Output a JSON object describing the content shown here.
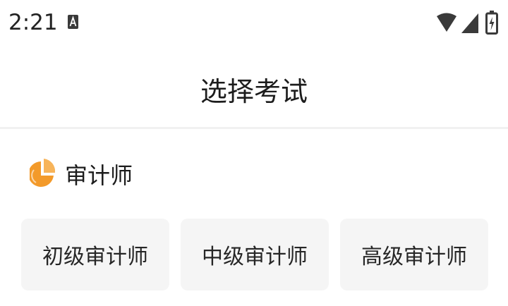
{
  "status_bar": {
    "time": "2:21",
    "icons": [
      "a-notification-icon",
      "wifi-icon",
      "cell-signal-icon",
      "battery-icon"
    ]
  },
  "header": {
    "title": "选择考试"
  },
  "section": {
    "icon": "pie-chart-icon",
    "title": "审计师",
    "accent_color": "#f39a2a"
  },
  "options": [
    {
      "label": "初级审计师"
    },
    {
      "label": "中级审计师"
    },
    {
      "label": "高级审计师"
    }
  ]
}
